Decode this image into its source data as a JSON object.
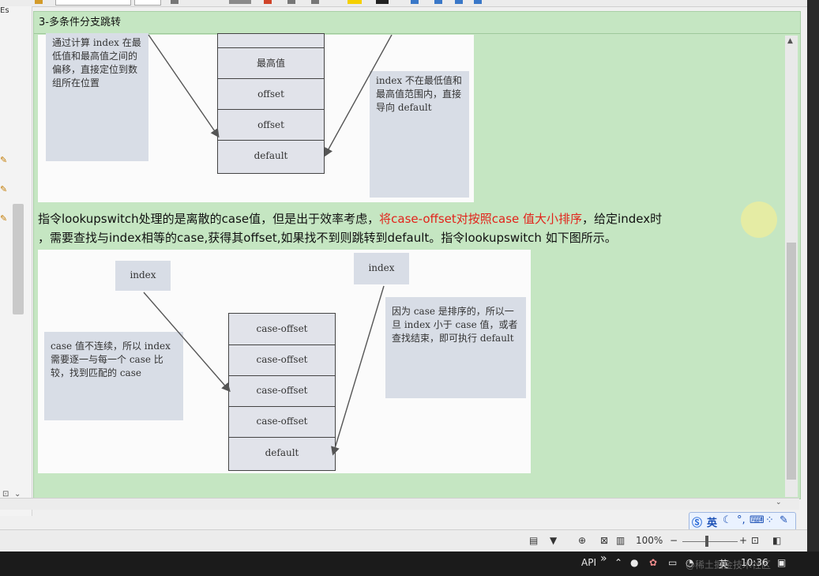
{
  "note": {
    "title": "3-多条件分支跳转"
  },
  "left_strip": {
    "cut_text": "Es"
  },
  "figure1": {
    "left_note": "通过计算 index 在最低值和最高值之间的偏移，直接定位到数组所在位置",
    "right_note": "index 不在最低值和最高值范围内，直接导向 default",
    "cells": [
      "最高值",
      "offset",
      "offset",
      "default"
    ]
  },
  "paragraph": {
    "seg1": "指令lookupswitch处理的是离散的case值，但是出于效率考虑，",
    "seg_red": "将case-offset对按照case 值大小排序",
    "seg2": "，给定index时",
    "line2": "，需要查找与index相等的case,获得其offset,如果找不到则跳转到default。指令lookupswitch 如下图所示。"
  },
  "figure2": {
    "index_left": "index",
    "index_right": "index",
    "left_note": "case 值不连续，所以 index 需要逐一与每一个 case 比较，找到匹配的 case",
    "right_note": "因为 case 是排序的，所以一旦 index 小于 case 值，或者查找结束，即可执行 default",
    "cells": [
      "case-offset",
      "case-offset",
      "case-offset",
      "case-offset",
      "default"
    ]
  },
  "status_bar": {
    "zoom": "100%"
  },
  "ime": {
    "lang": "英"
  },
  "taskbar": {
    "api_label": "API",
    "chevron": "»",
    "ime_label": "英",
    "time": "10:36",
    "watermark": "@稀土掘金技术社区"
  },
  "colors": {
    "note_bg": "#c5e6c2",
    "red_text": "#e2231a",
    "figure_box": "#d8dde6"
  }
}
